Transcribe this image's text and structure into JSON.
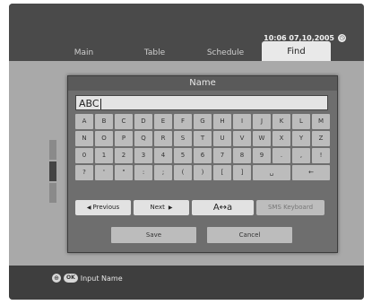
{
  "header": {
    "clock": "10:06 07,10,2005",
    "clock_icon": "clock-icon"
  },
  "tabs": [
    {
      "label": "Main"
    },
    {
      "label": "Table"
    },
    {
      "label": "Schedule"
    },
    {
      "label": "Find"
    }
  ],
  "dialog": {
    "title": "Name",
    "input_value": "ABC",
    "keys": [
      "A",
      "B",
      "C",
      "D",
      "E",
      "F",
      "G",
      "H",
      "I",
      "J",
      "K",
      "L",
      "M",
      "N",
      "O",
      "P",
      "Q",
      "R",
      "S",
      "T",
      "U",
      "V",
      "W",
      "X",
      "Y",
      "Z",
      "0",
      "1",
      "2",
      "3",
      "4",
      "5",
      "6",
      "7",
      "8",
      "9",
      ".",
      ",",
      "!",
      "?",
      "'",
      "\"",
      ":",
      ";",
      "(",
      ")",
      "[",
      "]",
      "␣",
      "←"
    ],
    "previous_label": "Previous",
    "next_label": "Next",
    "case_toggle_label": "A↔a",
    "sms_keyboard_label": "SMS Keyboard",
    "save_label": "Save",
    "cancel_label": "Cancel"
  },
  "status": {
    "ok_label": "OK",
    "text": "Input Name"
  }
}
